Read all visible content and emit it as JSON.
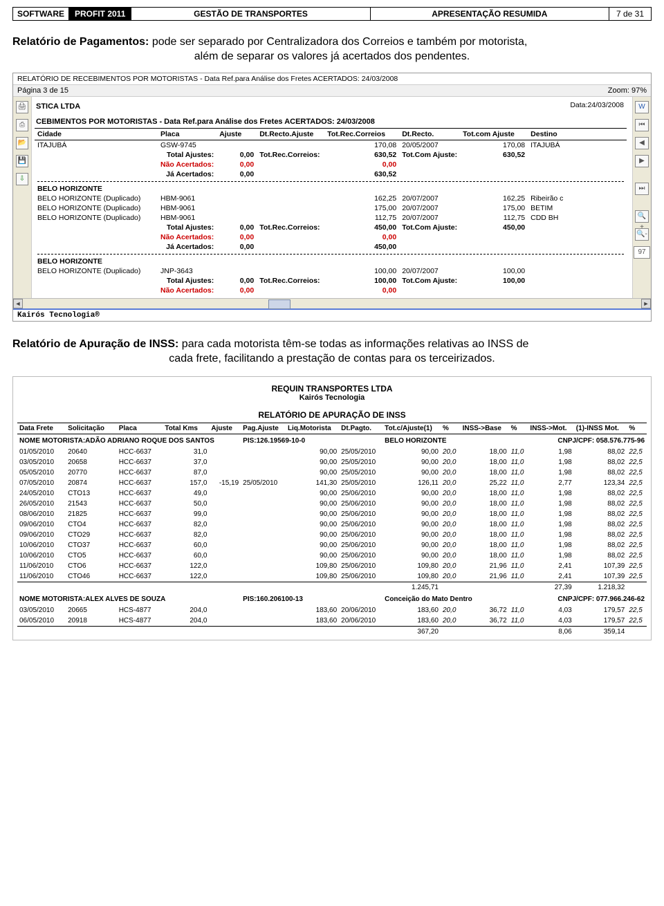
{
  "topbar": {
    "software": "SOFTWARE",
    "profit": "PROFIT 2011",
    "gestao": "GESTÃO DE TRANSPORTES",
    "apres": "APRESENTAÇÃO RESUMIDA",
    "page": "7 de 31"
  },
  "s1": {
    "titleBold": "Relatório de Pagamentos:",
    "titleRest": " pode ser separado por Centralizadora dos Correios e também por motorista,",
    "sub": "além de separar os valores já acertados dos pendentes."
  },
  "win": {
    "title": "RELATÓRIO DE RECEBIMENTOS POR MOTORISTAS - Data Ref.para Análise dos Fretes ACERTADOS: 24/03/2008",
    "pageLabel": "Página 3 de 15",
    "zoomLabel": "Zoom: 97%",
    "zoomBox": "97",
    "company": "STICA LTDA",
    "dataLabel": "Data:24/03/2008",
    "subHeader": "CEBIMENTOS POR MOTORISTAS - Data Ref.para Análise dos Fretes ACERTADOS: 24/03/2008",
    "cols": {
      "cidade": "Cidade",
      "placa": "Placa",
      "ajuste": "Ajuste",
      "dtRectoAjuste": "Dt.Recto.Ajuste",
      "totRecCorreios": "Tot.Rec.Correios",
      "dtRecto": "Dt.Recto.",
      "totComAjuste": "Tot.com Ajuste",
      "destino": "Destino"
    },
    "labels": {
      "totalAjustes": "Total Ajustes:",
      "totRecCorreiosL": "Tot.Rec.Correios:",
      "totComAjusteL": "Tot.Com Ajuste:",
      "naoAcertados": "Não Acertados:",
      "jaAcertados": "Já Acertados:"
    },
    "g1": {
      "rows": [
        {
          "cidade": "ITAJUBÁ",
          "placa": "GSW-9745",
          "totRec": "170,08",
          "dtRecto": "20/05/2007",
          "totAj": "170,08",
          "dest": "ITAJUBÁ"
        }
      ],
      "tot": {
        "aj": "0,00",
        "rec": "630,52",
        "ajt": "630,52"
      },
      "nao": {
        "aj": "0,00",
        "rec": "0,00"
      },
      "ja": {
        "aj": "0,00",
        "rec": "630,52"
      }
    },
    "g2": {
      "head": "BELO HORIZONTE",
      "rows": [
        {
          "cidade": "BELO HORIZONTE (Duplicado)",
          "placa": "HBM-9061",
          "totRec": "162,25",
          "dtRecto": "20/07/2007",
          "totAj": "162,25",
          "dest": "Ribeirão c"
        },
        {
          "cidade": "BELO HORIZONTE (Duplicado)",
          "placa": "HBM-9061",
          "totRec": "175,00",
          "dtRecto": "20/07/2007",
          "totAj": "175,00",
          "dest": "BETIM"
        },
        {
          "cidade": "BELO HORIZONTE (Duplicado)",
          "placa": "HBM-9061",
          "totRec": "112,75",
          "dtRecto": "20/07/2007",
          "totAj": "112,75",
          "dest": "CDD BH"
        }
      ],
      "tot": {
        "aj": "0,00",
        "rec": "450,00",
        "ajt": "450,00"
      },
      "nao": {
        "aj": "0,00",
        "rec": "0,00"
      },
      "ja": {
        "aj": "0,00",
        "rec": "450,00"
      }
    },
    "g3": {
      "head": "BELO HORIZONTE",
      "rows": [
        {
          "cidade": "BELO HORIZONTE (Duplicado)",
          "placa": "JNP-3643",
          "totRec": "100,00",
          "dtRecto": "20/07/2007",
          "totAj": "100,00",
          "dest": ""
        }
      ],
      "tot": {
        "aj": "0,00",
        "rec": "100,00",
        "ajt": "100,00"
      },
      "nao": {
        "aj": "0,00",
        "rec": "0,00"
      }
    },
    "footer": "Kairós Tecnologia®"
  },
  "s2": {
    "titleBold": "Relatório de Apuração de INSS:",
    "titleRest": " para cada motorista têm-se todas as informações relativas ao INSS de",
    "sub": "cada frete, facilitando a prestação de contas para os terceirizados."
  },
  "inss": {
    "company": "REQUIN TRANSPORTES LTDA",
    "kairos": "Kairós Tecnologia",
    "title": "RELATÓRIO DE APURAÇÃO DE INSS",
    "cols": {
      "dataFrete": "Data Frete",
      "solic": "Solicitação",
      "placa": "Placa",
      "km": "Total Kms",
      "ajuste": "Ajuste",
      "pagAjuste": "Pag.Ajuste",
      "liqMot": "Liq.Motorista",
      "dtPagto": "Dt.Pagto.",
      "totAj": "Tot.c/Ajuste(1)",
      "p1": "%",
      "inssBase": "INSS->Base",
      "p2": "%",
      "inssMot": "INSS->Mot.",
      "inss1": "(1)-INSS Mot.",
      "p3": "%"
    },
    "m1": {
      "label": "NOME MOTORISTA:ADÃO ADRIANO ROQUE DOS SANTOS",
      "pis": "PIS:126.19569-10-0",
      "city": "BELO HORIZONTE",
      "cnpj": "CNPJ/CPF:  058.576.775-96",
      "rows": [
        {
          "d": "01/05/2010",
          "s": "20640",
          "p": "HCC-6637",
          "k": "31,0",
          "aj": "",
          "pa": "",
          "lm": "90,00",
          "dp": "25/05/2010",
          "ta": "90,00",
          "p1": "20,0",
          "ib": "18,00",
          "p2": "11,0",
          "im": "1,98",
          "i1": "88,02",
          "p3": "22,5"
        },
        {
          "d": "03/05/2010",
          "s": "20658",
          "p": "HCC-6637",
          "k": "37,0",
          "aj": "",
          "pa": "",
          "lm": "90,00",
          "dp": "25/05/2010",
          "ta": "90,00",
          "p1": "20,0",
          "ib": "18,00",
          "p2": "11,0",
          "im": "1,98",
          "i1": "88,02",
          "p3": "22,5"
        },
        {
          "d": "05/05/2010",
          "s": "20770",
          "p": "HCC-6637",
          "k": "87,0",
          "aj": "",
          "pa": "",
          "lm": "90,00",
          "dp": "25/05/2010",
          "ta": "90,00",
          "p1": "20,0",
          "ib": "18,00",
          "p2": "11,0",
          "im": "1,98",
          "i1": "88,02",
          "p3": "22,5"
        },
        {
          "d": "07/05/2010",
          "s": "20874",
          "p": "HCC-6637",
          "k": "157,0",
          "aj": "-15,19",
          "pa": "25/05/2010",
          "lm": "141,30",
          "dp": "25/05/2010",
          "ta": "126,11",
          "p1": "20,0",
          "ib": "25,22",
          "p2": "11,0",
          "im": "2,77",
          "i1": "123,34",
          "p3": "22,5"
        },
        {
          "d": "24/05/2010",
          "s": "CTO13",
          "p": "HCC-6637",
          "k": "49,0",
          "aj": "",
          "pa": "",
          "lm": "90,00",
          "dp": "25/06/2010",
          "ta": "90,00",
          "p1": "20,0",
          "ib": "18,00",
          "p2": "11,0",
          "im": "1,98",
          "i1": "88,02",
          "p3": "22,5"
        },
        {
          "d": "26/05/2010",
          "s": "21543",
          "p": "HCC-6637",
          "k": "50,0",
          "aj": "",
          "pa": "",
          "lm": "90,00",
          "dp": "25/06/2010",
          "ta": "90,00",
          "p1": "20,0",
          "ib": "18,00",
          "p2": "11,0",
          "im": "1,98",
          "i1": "88,02",
          "p3": "22,5"
        },
        {
          "d": "08/06/2010",
          "s": "21825",
          "p": "HCC-6637",
          "k": "99,0",
          "aj": "",
          "pa": "",
          "lm": "90,00",
          "dp": "25/06/2010",
          "ta": "90,00",
          "p1": "20,0",
          "ib": "18,00",
          "p2": "11,0",
          "im": "1,98",
          "i1": "88,02",
          "p3": "22,5"
        },
        {
          "d": "09/06/2010",
          "s": "CTO4",
          "p": "HCC-6637",
          "k": "82,0",
          "aj": "",
          "pa": "",
          "lm": "90,00",
          "dp": "25/06/2010",
          "ta": "90,00",
          "p1": "20,0",
          "ib": "18,00",
          "p2": "11,0",
          "im": "1,98",
          "i1": "88,02",
          "p3": "22,5"
        },
        {
          "d": "09/06/2010",
          "s": "CTO29",
          "p": "HCC-6637",
          "k": "82,0",
          "aj": "",
          "pa": "",
          "lm": "90,00",
          "dp": "25/06/2010",
          "ta": "90,00",
          "p1": "20,0",
          "ib": "18,00",
          "p2": "11,0",
          "im": "1,98",
          "i1": "88,02",
          "p3": "22,5"
        },
        {
          "d": "10/06/2010",
          "s": "CTO37",
          "p": "HCC-6637",
          "k": "60,0",
          "aj": "",
          "pa": "",
          "lm": "90,00",
          "dp": "25/06/2010",
          "ta": "90,00",
          "p1": "20,0",
          "ib": "18,00",
          "p2": "11,0",
          "im": "1,98",
          "i1": "88,02",
          "p3": "22,5"
        },
        {
          "d": "10/06/2010",
          "s": "CTO5",
          "p": "HCC-6637",
          "k": "60,0",
          "aj": "",
          "pa": "",
          "lm": "90,00",
          "dp": "25/06/2010",
          "ta": "90,00",
          "p1": "20,0",
          "ib": "18,00",
          "p2": "11,0",
          "im": "1,98",
          "i1": "88,02",
          "p3": "22,5"
        },
        {
          "d": "11/06/2010",
          "s": "CTO6",
          "p": "HCC-6637",
          "k": "122,0",
          "aj": "",
          "pa": "",
          "lm": "109,80",
          "dp": "25/06/2010",
          "ta": "109,80",
          "p1": "20,0",
          "ib": "21,96",
          "p2": "11,0",
          "im": "2,41",
          "i1": "107,39",
          "p3": "22,5"
        },
        {
          "d": "11/06/2010",
          "s": "CTO46",
          "p": "HCC-6637",
          "k": "122,0",
          "aj": "",
          "pa": "",
          "lm": "109,80",
          "dp": "25/06/2010",
          "ta": "109,80",
          "p1": "20,0",
          "ib": "21,96",
          "p2": "11,0",
          "im": "2,41",
          "i1": "107,39",
          "p3": "22,5"
        }
      ],
      "sum": {
        "ta": "1.245,71",
        "im": "27,39",
        "i1": "1.218,32"
      }
    },
    "m2": {
      "label": "NOME MOTORISTA:ALEX ALVES DE SOUZA",
      "pis": "PIS:160.206100-13",
      "city": "Conceição do Mato Dentro",
      "cnpj": "CNPJ/CPF:  077.966.246-62",
      "rows": [
        {
          "d": "03/05/2010",
          "s": "20665",
          "p": "HCS-4877",
          "k": "204,0",
          "aj": "",
          "pa": "",
          "lm": "183,60",
          "dp": "20/06/2010",
          "ta": "183,60",
          "p1": "20,0",
          "ib": "36,72",
          "p2": "11,0",
          "im": "4,03",
          "i1": "179,57",
          "p3": "22,5"
        },
        {
          "d": "06/05/2010",
          "s": "20918",
          "p": "HCS-4877",
          "k": "204,0",
          "aj": "",
          "pa": "",
          "lm": "183,60",
          "dp": "20/06/2010",
          "ta": "183,60",
          "p1": "20,0",
          "ib": "36,72",
          "p2": "11,0",
          "im": "4,03",
          "i1": "179,57",
          "p3": "22,5"
        }
      ],
      "sum": {
        "ta": "367,20",
        "im": "8,06",
        "i1": "359,14"
      }
    }
  }
}
